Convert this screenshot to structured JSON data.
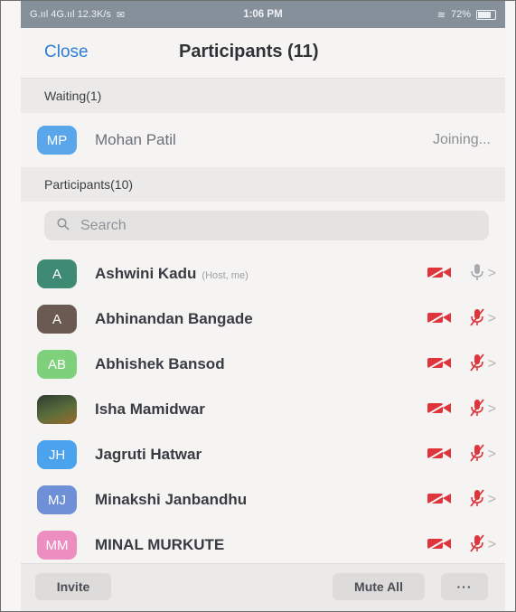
{
  "status_bar": {
    "left": "G.ııl 4G.ııl 12.3K/s",
    "time": "1:06 PM",
    "battery": "72%"
  },
  "header": {
    "close_label": "Close",
    "title": "Participants (11)"
  },
  "waiting": {
    "heading": "Waiting(1)",
    "person": {
      "initials": "MP",
      "name": "Mohan Patil",
      "status": "Joining...",
      "color": "#5aa6ea"
    }
  },
  "participants": {
    "heading": "Participants(10)",
    "search_placeholder": "Search",
    "items": [
      {
        "initials": "A",
        "name": "Ashwini Kadu",
        "tag": "(Host, me)",
        "color": "#3f8a73",
        "mic": "on"
      },
      {
        "initials": "A",
        "name": "Abhinandan Bangade",
        "tag": "",
        "color": "#6b5a52",
        "mic": "muted"
      },
      {
        "initials": "AB",
        "name": "Abhishek Bansod",
        "tag": "",
        "color": "#7fd07a",
        "mic": "muted"
      },
      {
        "initials": "",
        "name": "Isha Mamidwar",
        "tag": "",
        "color": "#3a4a3a",
        "mic": "muted",
        "photo": true
      },
      {
        "initials": "JH",
        "name": "Jagruti Hatwar",
        "tag": "",
        "color": "#4aa3ec",
        "mic": "muted"
      },
      {
        "initials": "MJ",
        "name": "Minakshi Janbandhu",
        "tag": "",
        "color": "#6f8fd6",
        "mic": "muted"
      },
      {
        "initials": "MM",
        "name": "MINAL MURKUTE",
        "tag": "",
        "color": "#ec8ec0",
        "mic": "muted"
      }
    ]
  },
  "footer": {
    "invite_label": "Invite",
    "mute_all_label": "Mute All",
    "more_label": "···"
  },
  "colors": {
    "accent": "#2c7cd8",
    "muted_red": "#e0343c",
    "mic_gray": "#a7abb0"
  }
}
